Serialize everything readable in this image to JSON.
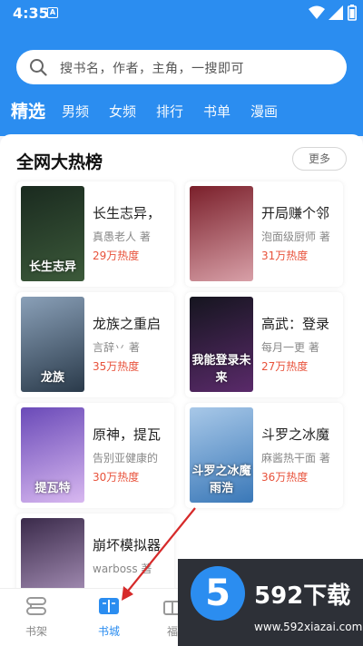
{
  "status": {
    "time": "4:35",
    "notif": "A"
  },
  "search": {
    "placeholder": "搜书名，作者，主角，一搜即可"
  },
  "tabs": [
    "精选",
    "男频",
    "女频",
    "排行",
    "书单",
    "漫画"
  ],
  "section": {
    "title": "全网大热榜",
    "more": "更多"
  },
  "books": [
    {
      "title": "长生志异，",
      "author": "真愚老人 著",
      "heat": "29万热度",
      "cover_text": "长生志异",
      "cover_colors": [
        "#1a2a1f",
        "#3c5a3a"
      ]
    },
    {
      "title": "开局赚个邻",
      "author": "泡面级厨师 著",
      "heat": "31万热度",
      "cover_text": "",
      "cover_colors": [
        "#7a1f2a",
        "#d8a0a8"
      ]
    },
    {
      "title": "龙族之重启",
      "author": "言辞丷 著",
      "heat": "35万热度",
      "cover_text": "龙族",
      "cover_colors": [
        "#8aa0b8",
        "#2a3a4a"
      ]
    },
    {
      "title": "高武：登录",
      "author": "每月一更 著",
      "heat": "27万热度",
      "cover_text": "我能登录未来",
      "cover_colors": [
        "#15151f",
        "#5a2a6a"
      ]
    },
    {
      "title": "原神，提瓦",
      "author": "告别亚健康的",
      "heat": "30万热度",
      "cover_text": "提瓦特",
      "cover_colors": [
        "#6a4ab8",
        "#d8b8f0"
      ]
    },
    {
      "title": "斗罗之冰魔",
      "author": "麻酱热干面 著",
      "heat": "36万热度",
      "cover_text": "斗罗之冰魔雨浩",
      "cover_colors": [
        "#a8c8e8",
        "#3a78b8"
      ]
    },
    {
      "title": "崩坏模拟器",
      "author": "warboss 著",
      "heat": "",
      "cover_text": "",
      "cover_colors": [
        "#3a2a4a",
        "#b8a0c8"
      ]
    }
  ],
  "nav": [
    {
      "label": "书架",
      "icon": "bookshelf-icon"
    },
    {
      "label": "书城",
      "icon": "book-open-icon"
    },
    {
      "label": "福",
      "icon": "gift-icon"
    }
  ],
  "watermark": {
    "logo": "5",
    "brand": "592下载",
    "url": "www.592xiazai.com"
  },
  "colors": {
    "accent": "#2b8df0",
    "heat": "#e8523b"
  }
}
